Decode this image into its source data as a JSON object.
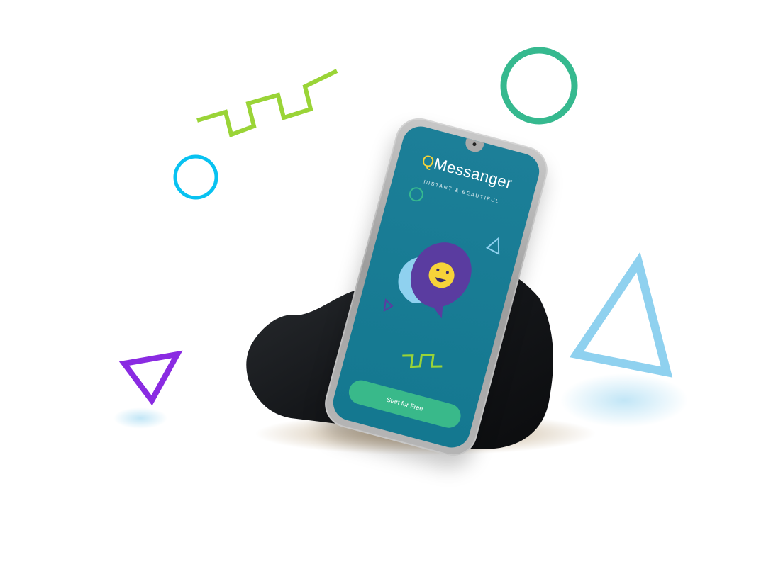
{
  "app": {
    "title_q": "Q",
    "title_rest": "Messanger",
    "subtitle": "INSTANT & BEAUTIFUL",
    "cta_label": "Start for Free"
  },
  "colors": {
    "screen": "#1a7d97",
    "accent_yellow": "#f6d339",
    "accent_green": "#39b98a",
    "bubble_purple": "#5a3ca0",
    "bubble_light_blue": "#8fd1ef",
    "lime": "#9ad437",
    "teal_green": "#36b98f",
    "cyan": "#08c2f1",
    "purple": "#8a2be2",
    "sky_blue": "#8fd1ef"
  },
  "icons": {
    "zigzag": "zigzag-icon",
    "circle": "ring-icon",
    "triangle": "triangle-icon",
    "smiley": "smiley-chat-icon",
    "rock": "rock-shape"
  }
}
